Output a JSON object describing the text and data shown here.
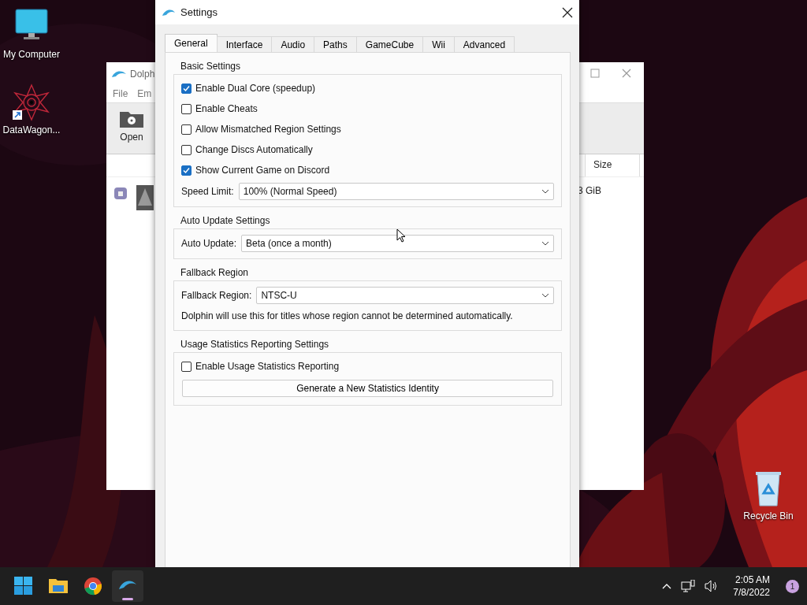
{
  "desktop_icons": [
    {
      "label": "My Computer",
      "kind": "computer"
    },
    {
      "label": "DataWagon...",
      "kind": "shortcut"
    },
    {
      "label": "Recycle Bin",
      "kind": "recycle"
    }
  ],
  "background_window": {
    "title": "Dolph",
    "menu": [
      "File",
      "Em"
    ],
    "toolbar": [
      {
        "label": "Open"
      }
    ],
    "columns": [
      "Size"
    ],
    "rows": [
      {
        "cell": "3 GiB"
      }
    ]
  },
  "settings": {
    "title": "Settings",
    "tabs": [
      {
        "label": "General",
        "selected": true
      },
      {
        "label": "Interface",
        "selected": false
      },
      {
        "label": "Audio",
        "selected": false
      },
      {
        "label": "Paths",
        "selected": false
      },
      {
        "label": "GameCube",
        "selected": false
      },
      {
        "label": "Wii",
        "selected": false
      },
      {
        "label": "Advanced",
        "selected": false
      }
    ],
    "groups": [
      {
        "title": "Basic Settings",
        "items": [
          {
            "kind": "checkbox",
            "label": "Enable Dual Core (speedup)",
            "checked": true
          },
          {
            "kind": "checkbox",
            "label": "Enable Cheats",
            "checked": false
          },
          {
            "kind": "checkbox",
            "label": "Allow Mismatched Region Settings",
            "checked": false
          },
          {
            "kind": "checkbox",
            "label": "Change Discs Automatically",
            "checked": false
          },
          {
            "kind": "checkbox",
            "label": "Show Current Game on Discord",
            "checked": true
          },
          {
            "kind": "dropdown",
            "label": "Speed Limit:",
            "value": "100% (Normal Speed)"
          }
        ]
      },
      {
        "title": "Auto Update Settings",
        "items": [
          {
            "kind": "dropdown",
            "label": "Auto Update:",
            "value": "Beta (once a month)"
          }
        ]
      },
      {
        "title": "Fallback Region",
        "items": [
          {
            "kind": "dropdown",
            "label": "Fallback Region:",
            "value": "NTSC-U"
          },
          {
            "kind": "note",
            "label": "Dolphin will use this for titles whose region cannot be determined automatically."
          }
        ]
      },
      {
        "title": "Usage Statistics Reporting Settings",
        "items": [
          {
            "kind": "checkbox",
            "label": "Enable Usage Statistics Reporting",
            "checked": false
          },
          {
            "kind": "button",
            "label": "Generate a New Statistics Identity"
          }
        ]
      }
    ]
  },
  "taskbar": {
    "apps": [
      {
        "kind": "start",
        "selected": false
      },
      {
        "kind": "folder",
        "selected": false
      },
      {
        "kind": "browser",
        "selected": false
      },
      {
        "kind": "dolphin",
        "selected": true
      }
    ],
    "time": "2:05 AM",
    "date": "7/8/2022",
    "notifications": "1"
  }
}
